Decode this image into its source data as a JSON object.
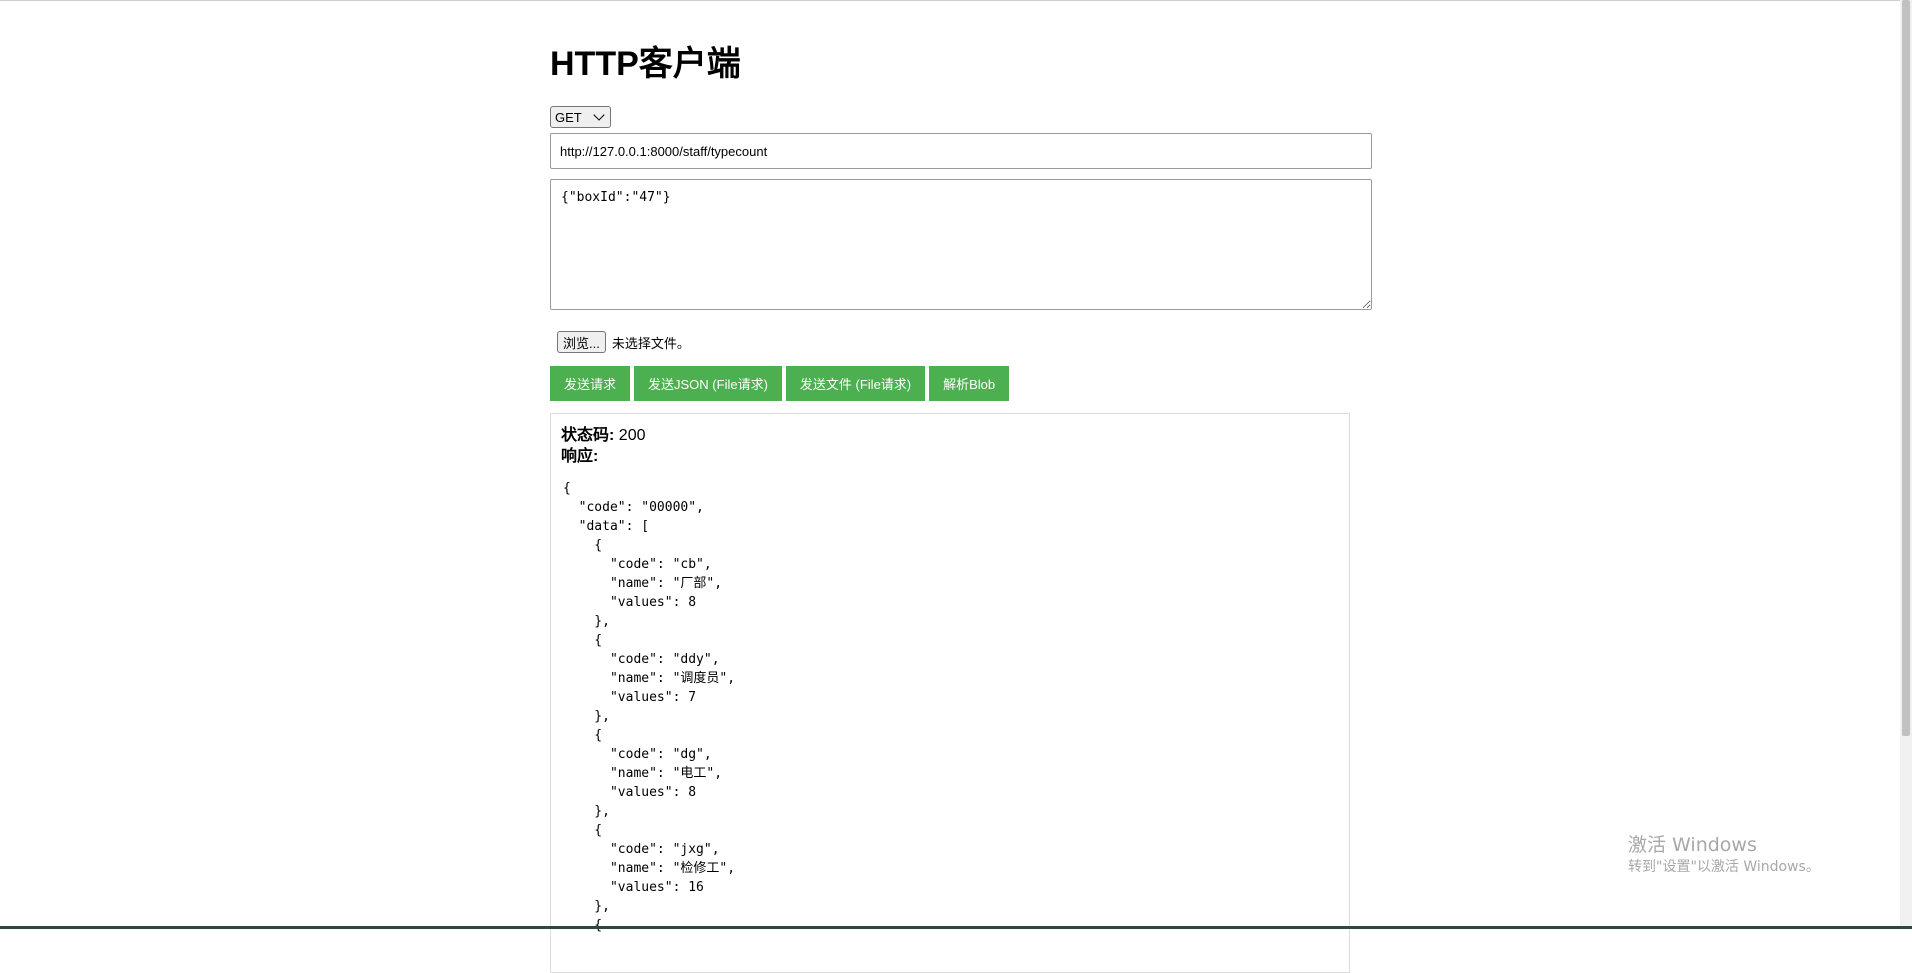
{
  "app": {
    "title": "HTTP客户端"
  },
  "request": {
    "method": "GET",
    "url": "http://127.0.0.1:8000/staff/typecount",
    "body": "{\"boxId\":\"47\"}"
  },
  "file": {
    "browse_label": "浏览...",
    "status_text": "未选择文件。"
  },
  "buttons": {
    "send": "发送请求",
    "send_json_file": "发送JSON (File请求)",
    "send_file": "发送文件 (File请求)",
    "parse_blob": "解析Blob"
  },
  "response": {
    "status_label": "状态码:",
    "status_code": "200",
    "response_label": "响应:",
    "body_text": "{\n  \"code\": \"00000\",\n  \"data\": [\n    {\n      \"code\": \"cb\",\n      \"name\": \"厂部\",\n      \"values\": 8\n    },\n    {\n      \"code\": \"ddy\",\n      \"name\": \"调度员\",\n      \"values\": 7\n    },\n    {\n      \"code\": \"dg\",\n      \"name\": \"电工\",\n      \"values\": 8\n    },\n    {\n      \"code\": \"jxg\",\n      \"name\": \"检修工\",\n      \"values\": 16\n    },\n    {"
  },
  "watermark": {
    "title": "激活 Windows",
    "subtitle": "转到\"设置\"以激活 Windows。"
  },
  "colors": {
    "button_bg": "#4caf50",
    "button_text": "#ffffff"
  }
}
